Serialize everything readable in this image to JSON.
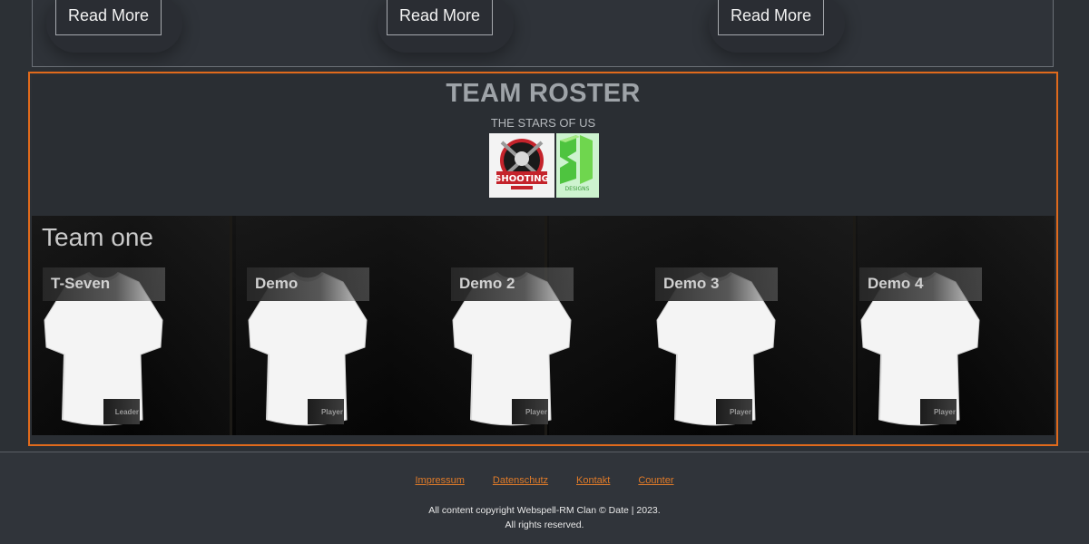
{
  "news": {
    "read_more_buttons": [
      {
        "label": "Read More"
      },
      {
        "label": "Read More"
      },
      {
        "label": "Read More"
      }
    ]
  },
  "roster": {
    "title": "TEAM ROSTER",
    "subtitle": "THE STARS OF US",
    "sponsors": [
      {
        "name": "shooting-logo",
        "text": "SHOOTING"
      },
      {
        "name": "21-designs-logo",
        "text": "DESIGNS"
      }
    ],
    "team": {
      "name": "Team one",
      "players": [
        {
          "name": "T-Seven",
          "role": "Leader"
        },
        {
          "name": "Demo",
          "role": "Player"
        },
        {
          "name": "Demo 2",
          "role": "Player"
        },
        {
          "name": "Demo 3",
          "role": "Player"
        },
        {
          "name": "Demo 4",
          "role": "Player"
        }
      ]
    }
  },
  "footer": {
    "links": [
      {
        "label": "Impressum"
      },
      {
        "label": "Datenschutz"
      },
      {
        "label": "Kontakt"
      },
      {
        "label": "Counter"
      }
    ],
    "copyright_line1": "All content copyright Webspell-RM Clan © Date | 2023.",
    "copyright_line2": "All rights reserved."
  },
  "colors": {
    "accent": "#e06a1c",
    "link": "#e07b29",
    "background": "#2c3035"
  }
}
